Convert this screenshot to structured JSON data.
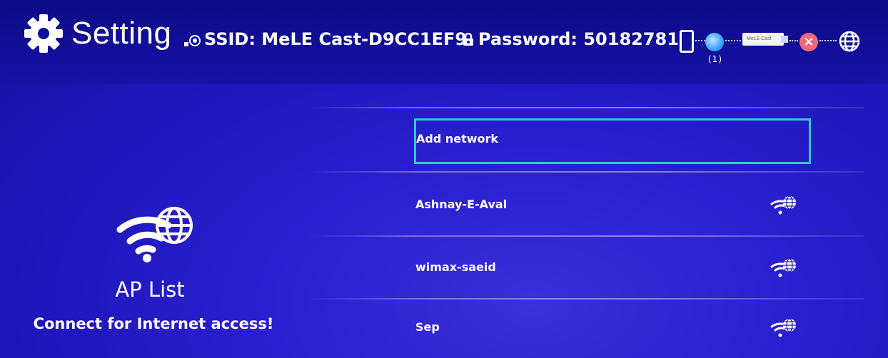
{
  "header": {
    "title": "Setting",
    "ssid": "SSID: MeLE Cast-D9CC1EF9",
    "password": "Password: 50182781"
  },
  "status_bar": {
    "connected_count": "(1)",
    "dongle_label": "MeLE Cast",
    "icons": [
      "phone-icon",
      "router-icon",
      "dongle-icon",
      "disconnected-x-icon",
      "globe-icon"
    ]
  },
  "side_panel": {
    "title": "AP List",
    "subtitle": "Connect for Internet access!"
  },
  "networks": [
    {
      "label": "Add network",
      "selected": true
    },
    {
      "label": "Ashnay-E-Aval",
      "icon": "wifi-globe-icon"
    },
    {
      "label": "wimax-saeid",
      "icon": "wifi-globe-icon"
    },
    {
      "label": "Sep",
      "icon": "wifi-globe-icon"
    }
  ],
  "colors": {
    "background": "#1c16b8",
    "selection_border": "#33c8d6",
    "disconnected": "#f26a7a"
  }
}
